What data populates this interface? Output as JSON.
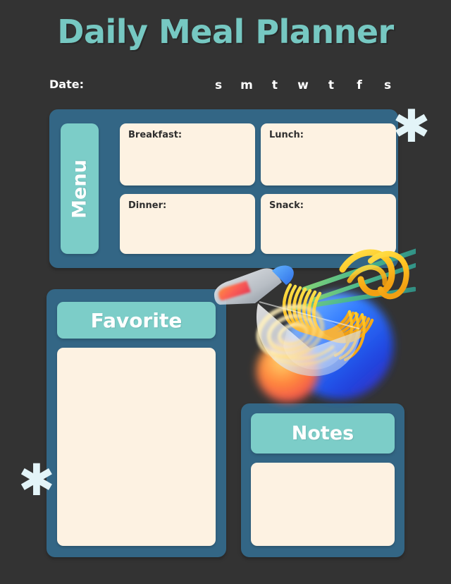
{
  "header": {
    "title": "Daily Meal Planner",
    "date_label": "Date:",
    "weekdays": [
      "s",
      "m",
      "t",
      "w",
      "t",
      "f",
      "s"
    ]
  },
  "menu": {
    "tab_label": "Menu",
    "cards": [
      {
        "label": "Breakfast:",
        "value": ""
      },
      {
        "label": "Lunch:",
        "value": ""
      },
      {
        "label": "Dinner:",
        "value": ""
      },
      {
        "label": "Snack:",
        "value": ""
      }
    ]
  },
  "favorite": {
    "header": "Favorite",
    "value": ""
  },
  "notes": {
    "header": "Notes",
    "value": ""
  },
  "decorations": {
    "asterisk_glyph": "✱",
    "illustration_name": "noodle-bowl-chopsticks-sauce-illustration"
  },
  "colors": {
    "background": "#333333",
    "panel_blue": "#336685",
    "mint": "#7ccdc8",
    "cream": "#fdf2e2",
    "title_mint": "#76c8c2",
    "text_light": "#ffffff",
    "text_dark": "#2e2e2e",
    "asterisk": "#e3f4f8"
  }
}
